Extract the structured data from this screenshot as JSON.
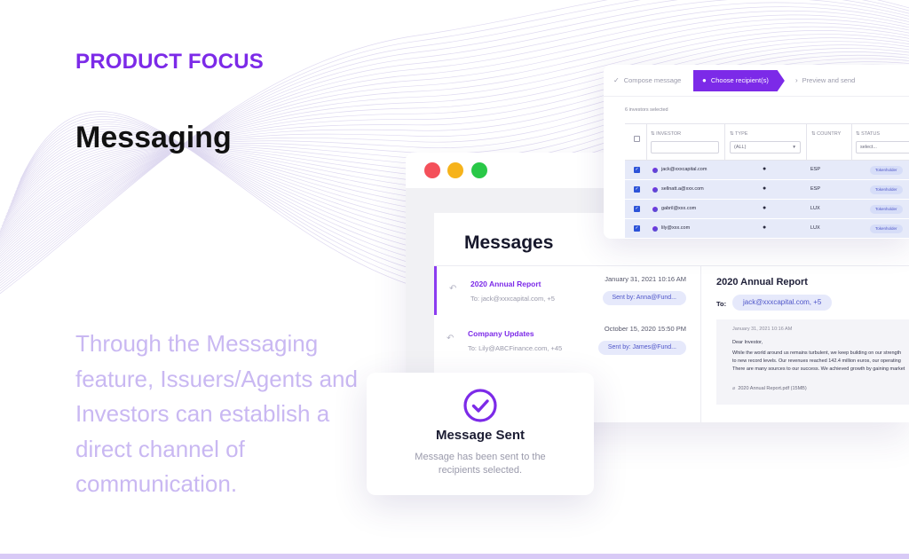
{
  "hero": {
    "eyebrow": "PRODUCT FOCUS",
    "title": "Messaging",
    "description": "Through the Messaging feature, Issuers/Agents and Investors can establish a direct channel of communication."
  },
  "colors": {
    "accent": "#7c2ae8",
    "tagline": "#c9b8f2",
    "chip_bg": "#e6e9fb",
    "window_red": "#f4505a",
    "window_yellow": "#f6b31b",
    "window_green": "#29c847"
  },
  "messages": {
    "title": "Messages",
    "items": [
      {
        "subject": "2020 Annual Report",
        "to": "To: jack@xxxcapital.com, +5",
        "date": "January 31, 2021 10:16 AM",
        "sender": "Sent by: Anna@Fund..."
      },
      {
        "subject": "Company Updates",
        "to": "To: Lily@ABCFinance.com, +45",
        "date": "October 15, 2020 15:50 PM",
        "sender": "Sent by: James@Fund..."
      }
    ],
    "detail": {
      "title": "2020 Annual Report",
      "to_label": "To:",
      "to_value": "jack@xxxcapital.com, +5",
      "date": "January 31, 2021 10:16 AM",
      "greeting": "Dear Investor,",
      "lines": [
        "While the world around us remains turbulent, we keep building on our strength",
        "to new record levels. Our revenues reached 142.4 million euros, our operating",
        "There are many sources to our success. We achieved growth by gaining market"
      ],
      "attachment": "2020 Annual Report.pdf (15MB)"
    }
  },
  "recipients": {
    "steps": [
      "Compose message",
      "Choose recipient(s)",
      "Preview and send"
    ],
    "selected_count": "6 investors selected",
    "columns": [
      "INVESTOR",
      "TYPE",
      "COUNTRY",
      "STATUS"
    ],
    "type_filter": "(ALL)",
    "status_filter": "select...",
    "rows": [
      {
        "email": "jack@xxxcapital.com",
        "country": "ESP",
        "status": "Tokenholder"
      },
      {
        "email": "sellnatt.a@xxx.com",
        "country": "ESP",
        "status": "Tokenholder"
      },
      {
        "email": "gabril@xxx.com",
        "country": "LUX",
        "status": "Tokenholder"
      },
      {
        "email": "lily@xxx.com",
        "country": "LUX",
        "status": "Tokenholder"
      }
    ]
  },
  "toast": {
    "title": "Message Sent",
    "body": "Message has been sent to the recipients selected."
  },
  "icons": [
    "check-circle-icon",
    "reply-icon",
    "person-icon",
    "paperclip-icon",
    "check-icon",
    "filter-arrow-icon",
    "dropdown-caret-icon"
  ]
}
